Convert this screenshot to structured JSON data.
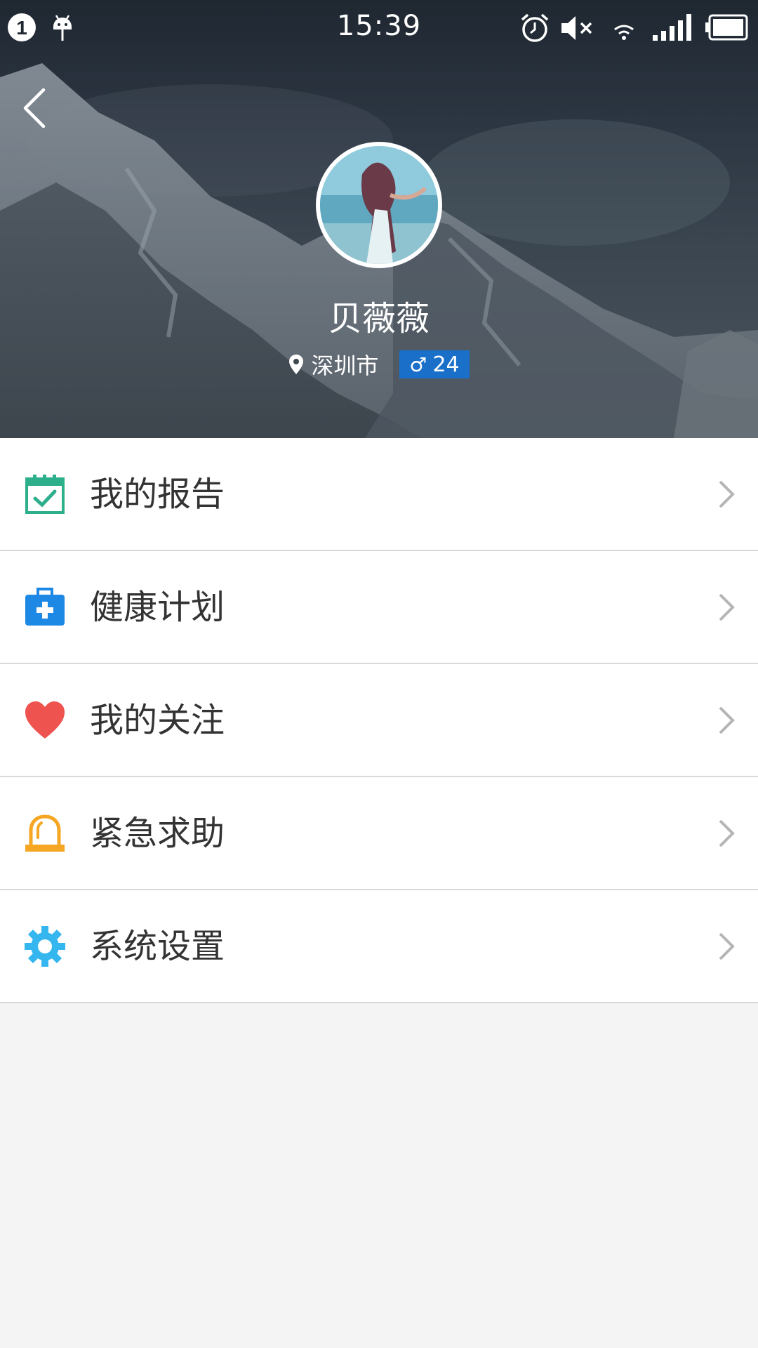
{
  "status_bar": {
    "time": "15:39",
    "notification_count": "1",
    "left_icons": [
      "notification-count-icon",
      "android-icon"
    ],
    "right_icons": [
      "alarm-icon",
      "mute-icon",
      "wifi-icon",
      "signal-icon",
      "battery-icon"
    ]
  },
  "header": {
    "back_icon": "back-arrow-icon",
    "avatar": "user-avatar-photo",
    "name": "贝薇薇",
    "location": "深圳市",
    "gender_symbol": "♂",
    "age": "24",
    "badge_color": "#1a6fc9"
  },
  "menu": {
    "items": [
      {
        "label": "我的报告",
        "icon": "calendar-check-icon",
        "color": "#2eaf8c"
      },
      {
        "label": "健康计划",
        "icon": "medical-kit-icon",
        "color": "#1e88e5"
      },
      {
        "label": "我的关注",
        "icon": "heart-icon",
        "color": "#ef5350"
      },
      {
        "label": "紧急求助",
        "icon": "alarm-beacon-icon",
        "color": "#f5a623"
      },
      {
        "label": "系统设置",
        "icon": "gear-icon",
        "color": "#35b6ee"
      }
    ]
  }
}
